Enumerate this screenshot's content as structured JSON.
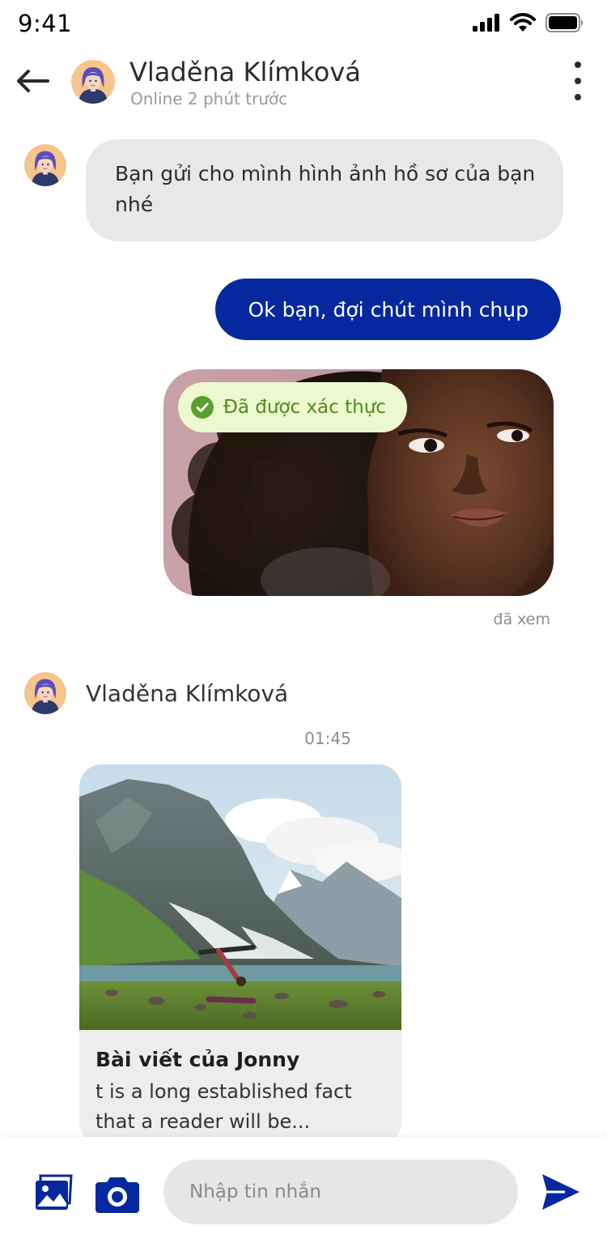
{
  "status_bar": {
    "time": "9:41",
    "icons": [
      "signal-icon",
      "wifi-icon",
      "battery-icon"
    ]
  },
  "header": {
    "back_icon": "arrow-left-icon",
    "contact_name": "Vladěna Klímková",
    "presence": "Online 2 phút trước",
    "more_icon": "more-vertical-icon"
  },
  "messages": [
    {
      "direction": "incoming",
      "type": "text",
      "text": "Bạn gửi cho mình hình ảnh hồ sơ của bạn nhé"
    },
    {
      "direction": "outgoing",
      "type": "text",
      "text": "Ok bạn, đợi chút mình chụp"
    },
    {
      "direction": "outgoing",
      "type": "photo",
      "badge": "Đã được xác thực",
      "badge_icon": "check-circle-icon",
      "status": "đã xem"
    },
    {
      "direction": "incoming",
      "type": "post",
      "sender": "Vladěna Klímková",
      "time": "01:45",
      "title": "Bài viết của Jonny",
      "excerpt": "t is a long established fact that a reader will be..."
    }
  ],
  "composer": {
    "gallery_icon": "image-gallery-icon",
    "camera_icon": "camera-icon",
    "placeholder": "Nhập tin nhắn",
    "send_icon": "send-icon"
  },
  "colors": {
    "accent": "#06289e",
    "bubble_incoming": "#e8e8e8",
    "badge_bg": "#ecf8cd",
    "badge_text": "#4f8a1f"
  }
}
